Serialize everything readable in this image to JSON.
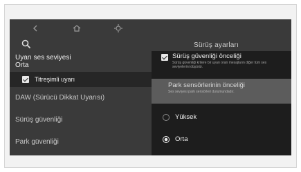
{
  "header": {
    "title": "Sürüş ayarları"
  },
  "icons": {
    "back": "back-icon",
    "home": "home-icon",
    "settings": "gear-icon",
    "search": "search-icon"
  },
  "sidebar": {
    "warning_volume": {
      "label": "Uyarı ses seviyesi",
      "value": "Orta"
    },
    "vibration": {
      "label": "Titreşimli uyarı",
      "checked": true
    },
    "items": [
      {
        "label": "DAW (Sürücü Dikkat Uyarısı)"
      },
      {
        "label": "Sürüş güvenliği"
      },
      {
        "label": "Park güvenliği"
      }
    ]
  },
  "panel": {
    "driving_safety_priority": {
      "title": "Sürüş güvenliği önceliği",
      "description": "Sürüş güvenliği kritere bir uyarı oran mesajların diğer tüm ses seviyelerini düşürür.",
      "checked": true
    },
    "park_sensor_priority": {
      "title": "Park sensörlerinin önceliği",
      "description": "Ses seviyesi park sensörleri durumundadır."
    },
    "options": [
      {
        "label": "Yüksek",
        "selected": false
      },
      {
        "label": "Orta",
        "selected": true
      }
    ]
  }
}
